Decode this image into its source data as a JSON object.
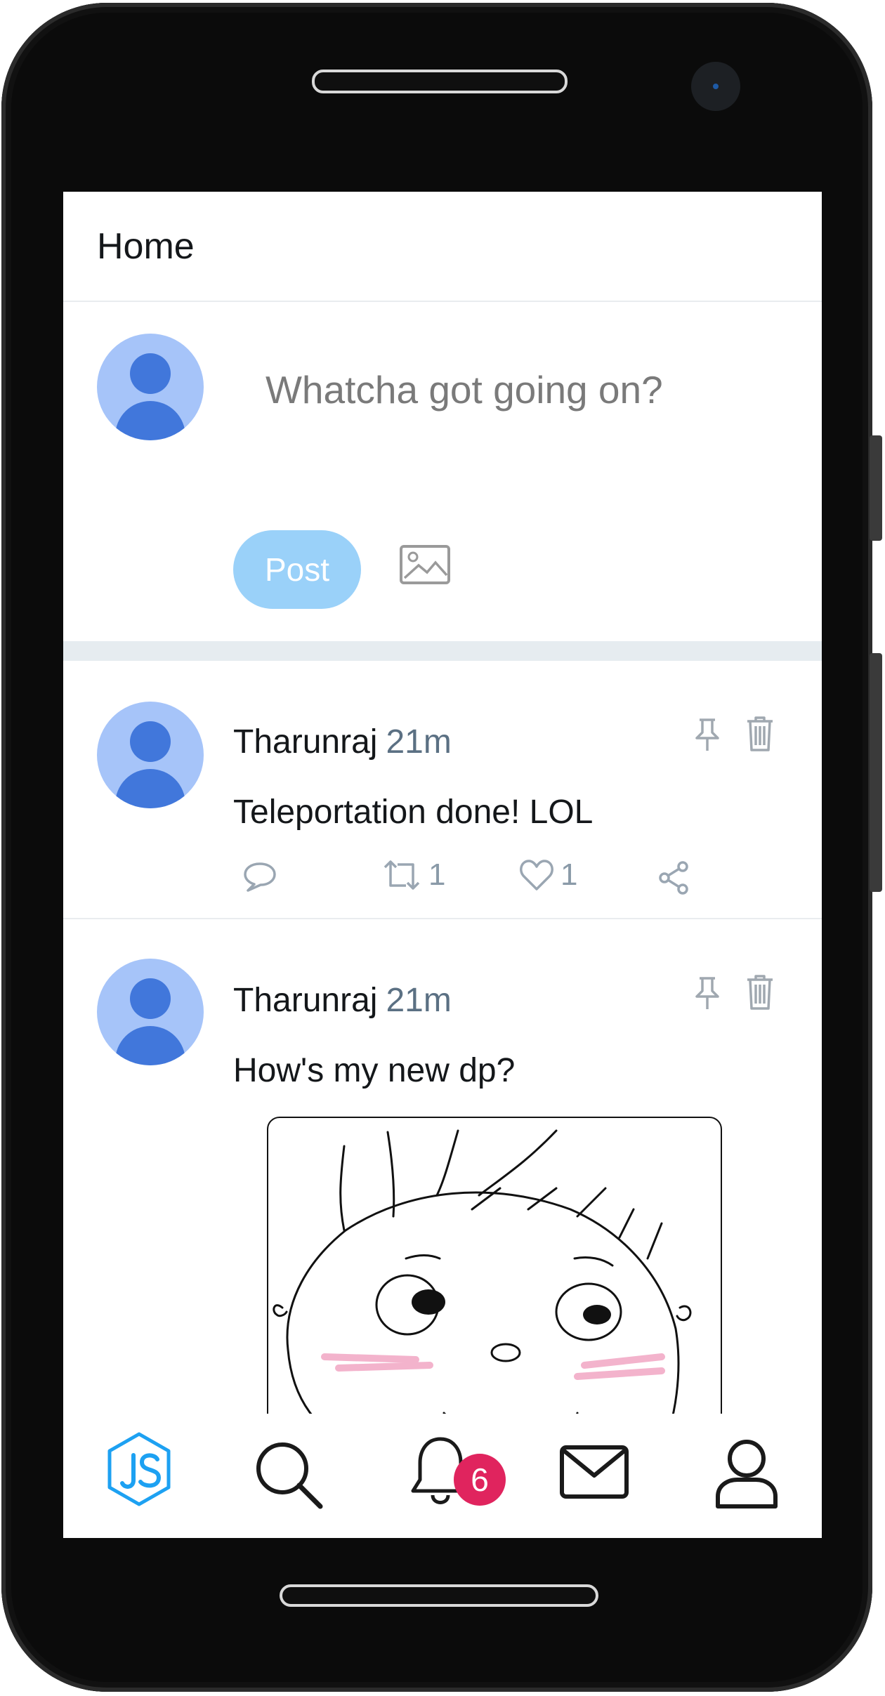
{
  "header": {
    "title": "Home"
  },
  "compose": {
    "placeholder": "Whatcha got going on?",
    "post_label": "Post",
    "image_icon": "image-icon"
  },
  "feed": [
    {
      "author": "Tharunraj",
      "time": "21m",
      "text": "Teleportation done! LOL",
      "retweets": "1",
      "likes": "1"
    },
    {
      "author": "Tharunraj",
      "time": "21m",
      "text": "How's my new dp?",
      "has_image": true
    }
  ],
  "nav": {
    "items": [
      "js-logo-icon",
      "search-icon",
      "bell-icon",
      "mail-icon",
      "user-icon"
    ],
    "notification_count": "6"
  },
  "colors": {
    "accent": "#1da1f2",
    "post_button": "#9ad1f9",
    "badge": "#e0245e",
    "avatar_bg": "#a6c4f9",
    "avatar_fg": "#4177db"
  }
}
